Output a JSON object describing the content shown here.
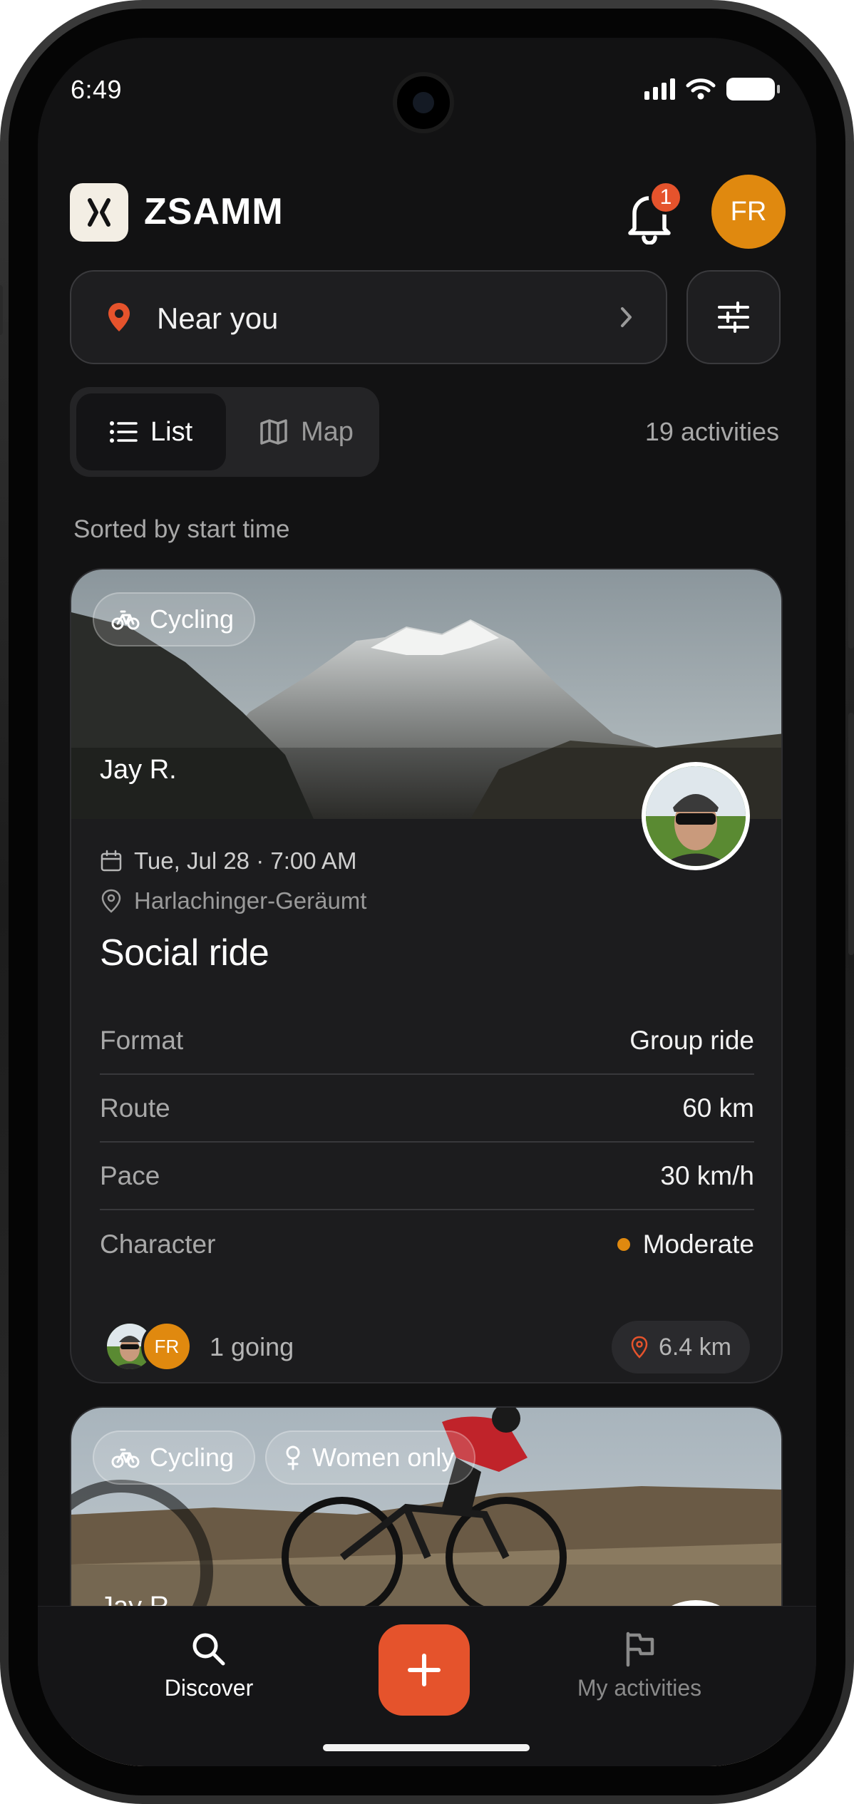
{
  "status_bar": {
    "time": "6:49"
  },
  "header": {
    "app_name": "ZSAMM",
    "notification_count": "1",
    "user_initials": "FR"
  },
  "location": {
    "label": "Near you"
  },
  "view_toggle": {
    "list_label": "List",
    "map_label": "Map",
    "selected": "List"
  },
  "results": {
    "count_label": "19 activities",
    "sort_label": "Sorted by start time"
  },
  "activities": [
    {
      "tags": [
        "Cycling"
      ],
      "host": "Jay R.",
      "datetime": "Tue, Jul 28 · 7:00 AM",
      "location": "Harlachinger-Geräumt",
      "title": "Social ride",
      "details": [
        {
          "label": "Format",
          "value": "Group ride"
        },
        {
          "label": "Route",
          "value": "60 km"
        },
        {
          "label": "Pace",
          "value": "30 km/h"
        },
        {
          "label": "Character",
          "value": "Moderate",
          "indicator_color": "#e0890f"
        }
      ],
      "attendee_initials": "FR",
      "going": "1 going",
      "distance": "6.4 km"
    },
    {
      "tags": [
        "Cycling",
        "Women only"
      ],
      "host": "Jay R."
    }
  ],
  "bottom_nav": {
    "discover_label": "Discover",
    "my_activities_label": "My activities"
  },
  "colors": {
    "accent": "#e5532c",
    "avatar": "#e0890f",
    "background": "#121213",
    "card": "#1c1c1e"
  }
}
